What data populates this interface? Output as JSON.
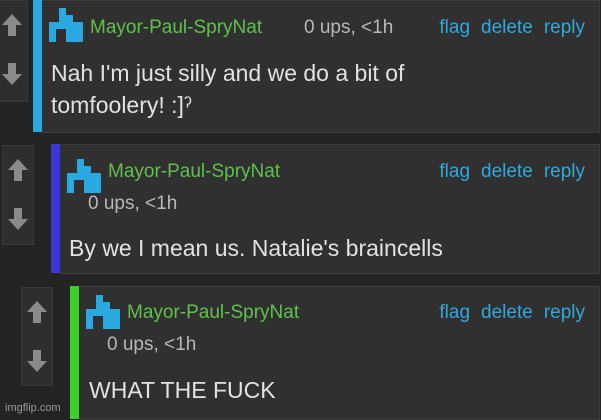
{
  "comments": [
    {
      "username": "Mayor-Paul-SpryNat",
      "meta": "0 ups, <1h",
      "actions": {
        "flag": "flag",
        "delete": "delete",
        "reply": "reply"
      },
      "body": "Nah I'm just silly and we do a bit of tomfoolery! :]ˀ",
      "thread_color": "#2aa8e0"
    },
    {
      "username": "Mayor-Paul-SpryNat",
      "meta": "0 ups, <1h",
      "actions": {
        "flag": "flag",
        "delete": "delete",
        "reply": "reply"
      },
      "body": "By we I mean us. Natalie's braincells",
      "thread_color": "#3b36d8"
    },
    {
      "username": "Mayor-Paul-SpryNat",
      "meta": "0 ups, <1h",
      "actions": {
        "flag": "flag",
        "delete": "delete",
        "reply": "reply"
      },
      "body": "WHAT THE FUCK",
      "thread_color": "#3bd12a"
    }
  ],
  "icons": {
    "upvote": "arrow-up-icon",
    "downvote": "arrow-down-icon",
    "avatar": "pixel-avatar-icon"
  },
  "watermark": "imgflip.com"
}
